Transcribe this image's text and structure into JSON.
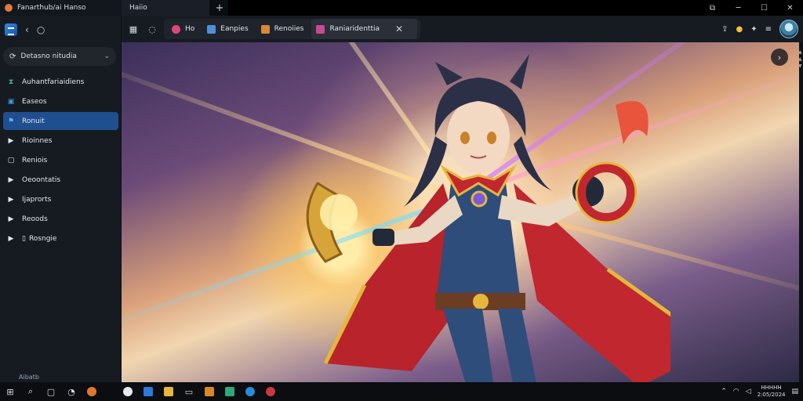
{
  "titlebar": {
    "app_title": "Fanarthub/ai Hanso",
    "window_tab": "Haiio",
    "new_tab_icon": "plus-icon",
    "controls": [
      "pin-icon",
      "minimize-icon",
      "maximize-icon",
      "close-icon"
    ]
  },
  "sidebar": {
    "search_label": "Detasno nitudia",
    "items": [
      {
        "label": "Auhantfariaidiens",
        "icon": "people-icon",
        "color": "#3fb58a"
      },
      {
        "label": "Easeos",
        "icon": "image-icon",
        "color": "#3a9be0"
      },
      {
        "label": "Ronuit",
        "icon": "flag-icon",
        "color": "#62b3ff",
        "active": true
      },
      {
        "label": "Rioinnes",
        "icon": "chevron-right-icon"
      },
      {
        "label": "Reniois",
        "icon": "folder-icon"
      },
      {
        "label": "Oeoontatis",
        "icon": "chevron-right-icon"
      },
      {
        "label": "Ijaprorts",
        "icon": "chevron-right-icon"
      },
      {
        "label": "Reoods",
        "icon": "chevron-right-icon"
      },
      {
        "label": "Rosngie",
        "icon": "chevron-right-icon"
      }
    ],
    "bottom_label": "Aibatb"
  },
  "toolbar": {
    "tabs": [
      {
        "label": "Ho",
        "color": "#e0457a"
      },
      {
        "label": "Eanpies",
        "color": "#4f8fd6"
      },
      {
        "label": "Renoiies",
        "color": "#d9883a"
      },
      {
        "label": "Raniaridenttia",
        "color": "#c94a8c"
      }
    ],
    "right_icons": [
      "share-icon",
      "bell-icon",
      "sparkle-icon",
      "more-icon"
    ]
  },
  "content": {
    "next_icon": "chevron-right-icon",
    "image_description": "anime-heroine-artwork"
  },
  "taskbar": {
    "clock_time": "HHHHH",
    "clock_date": "2:05/2024"
  }
}
